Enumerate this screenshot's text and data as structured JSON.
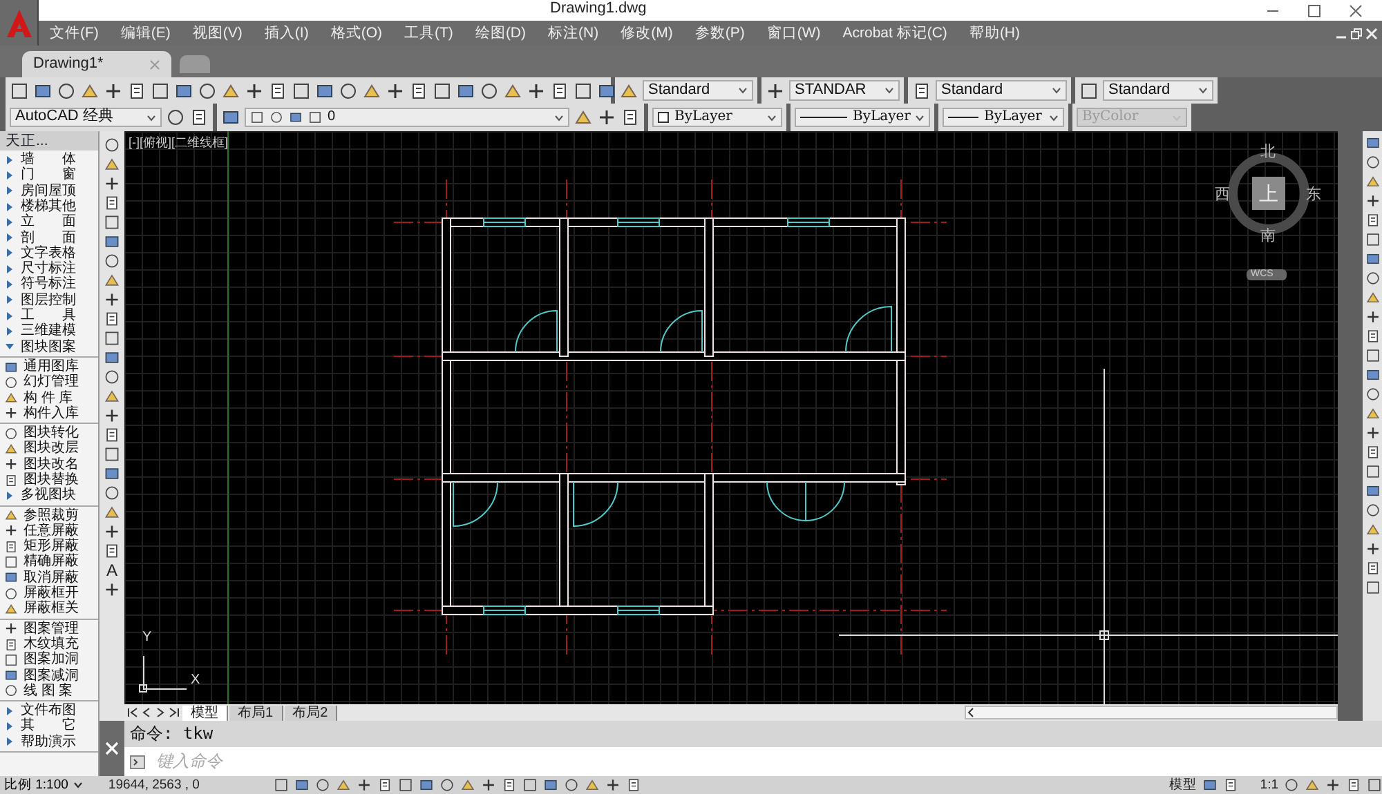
{
  "window": {
    "title": "Drawing1.dwg"
  },
  "menu": [
    "文件(F)",
    "编辑(E)",
    "视图(V)",
    "插入(I)",
    "格式(O)",
    "工具(T)",
    "绘图(D)",
    "标注(N)",
    "修改(M)",
    "参数(P)",
    "窗口(W)",
    "Acrobat 标记(C)",
    "帮助(H)"
  ],
  "doc_tabs": [
    {
      "label": "Drawing1*",
      "selected": true
    }
  ],
  "style_toolbar": [
    "Standard",
    "STANDAR",
    "Standard",
    "Standard"
  ],
  "properties_bar": {
    "workspace": "AutoCAD 经典",
    "layer": "0",
    "color_setting": "ByLayer",
    "linetype": "ByLayer",
    "lineweight": "ByLayer",
    "plot_style": {
      "value": "ByColor",
      "disabled": true
    }
  },
  "side_panel": {
    "title": "天正...",
    "groups": [
      [
        {
          "label": "墙　　体",
          "kind": "submenu"
        },
        {
          "label": "门　　窗",
          "kind": "submenu"
        },
        {
          "label": "房间屋顶",
          "kind": "submenu"
        },
        {
          "label": "楼梯其他",
          "kind": "submenu"
        },
        {
          "label": "立　　面",
          "kind": "submenu"
        },
        {
          "label": "剖　　面",
          "kind": "submenu"
        },
        {
          "label": "文字表格",
          "kind": "submenu"
        },
        {
          "label": "尺寸标注",
          "kind": "submenu"
        },
        {
          "label": "符号标注",
          "kind": "submenu"
        },
        {
          "label": "图层控制",
          "kind": "submenu"
        },
        {
          "label": "工　　具",
          "kind": "submenu"
        },
        {
          "label": "三维建模",
          "kind": "submenu"
        },
        {
          "label": "图块图案",
          "kind": "open"
        }
      ],
      [
        {
          "label": "通用图库",
          "kind": "tool"
        },
        {
          "label": "幻灯管理",
          "kind": "tool"
        },
        {
          "label": "构 件 库",
          "kind": "tool"
        },
        {
          "label": "构件入库",
          "kind": "tool"
        }
      ],
      [
        {
          "label": "图块转化",
          "kind": "tool"
        },
        {
          "label": "图块改层",
          "kind": "tool"
        },
        {
          "label": "图块改名",
          "kind": "tool"
        },
        {
          "label": "图块替换",
          "kind": "tool"
        },
        {
          "label": "多视图块",
          "kind": "submenu"
        }
      ],
      [
        {
          "label": "参照裁剪",
          "kind": "tool"
        },
        {
          "label": "任意屏蔽",
          "kind": "tool"
        },
        {
          "label": "矩形屏蔽",
          "kind": "tool"
        },
        {
          "label": "精确屏蔽",
          "kind": "tool"
        },
        {
          "label": "取消屏蔽",
          "kind": "tool"
        },
        {
          "label": "屏蔽框开",
          "kind": "tool"
        },
        {
          "label": "屏蔽框关",
          "kind": "tool"
        }
      ],
      [
        {
          "label": "图案管理",
          "kind": "tool"
        },
        {
          "label": "木纹填充",
          "kind": "tool"
        },
        {
          "label": "图案加洞",
          "kind": "tool"
        },
        {
          "label": "图案减洞",
          "kind": "tool"
        },
        {
          "label": "线 图 案",
          "kind": "tool"
        }
      ],
      [
        {
          "label": "文件布图",
          "kind": "submenu"
        },
        {
          "label": "其　　它",
          "kind": "submenu"
        },
        {
          "label": "帮助演示",
          "kind": "submenu"
        }
      ]
    ]
  },
  "draw_toolbar": {
    "text_tool": "A"
  },
  "viewport": {
    "label": "[-][俯视][二维线框]",
    "viewcube": {
      "north": "北",
      "west": "西",
      "top": "上",
      "east": "东",
      "south": "南",
      "ucs": "WCS"
    },
    "ucs_icon": {
      "x": "X",
      "y": "Y"
    }
  },
  "layout_tabs": [
    {
      "label": "模型",
      "selected": true
    },
    {
      "label": "布局1",
      "selected": false
    },
    {
      "label": "布局2",
      "selected": false
    }
  ],
  "command": {
    "history": "命令: tkw",
    "placeholder": "键入命令"
  },
  "status_bar": {
    "scale": "比例 1:100",
    "coordinates": "19644, 2563 , 0",
    "space": "模型",
    "annotation_scale": "1:1"
  }
}
